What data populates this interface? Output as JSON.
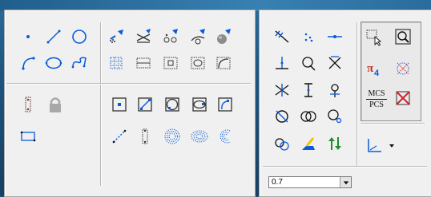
{
  "window": {
    "title": ""
  },
  "left_toolbar": {
    "row1": [
      "point-tool",
      "line-tool",
      "circle-tool",
      "arrow-plane-tool",
      "cross-lines-tool",
      "small-circles-tool",
      "angle-plane-tool",
      "grey-blob-tool"
    ],
    "row2": [
      "arc-tool",
      "ellipse-tool",
      "spline-tool",
      "dotted-grid-tool",
      "rect-lines-tool",
      "dotted-square-tool",
      "dotted-ellipse-tool",
      "dotted-corner-tool"
    ],
    "row3": [
      "dotted-vertical-rect-tool",
      "lock-tool",
      "bounded-square-tool",
      "bounded-diagonal-tool",
      "bounded-circle-tool",
      "bounded-oval-tool",
      "bounded-curve-tool"
    ],
    "row4": [
      "dotted-rect-tool",
      "dashed-diagonal-tool",
      "dotted-capsule-tool",
      "concentric-circles-tool",
      "concentric-ovals-tool",
      "c-shape-tool"
    ]
  },
  "right_toolbar": {
    "grid": [
      "arrow-x-tool",
      "dots-tool",
      "bar-tool",
      "perpendicular-tool",
      "triangle-a-tool",
      "x-cross-tool",
      "bowtie-tool",
      "i-beam-tool",
      "pin-tool",
      "circle-slash-tool",
      "double-circle-tool",
      "circle-dot-tool",
      "stacked-circles-tool",
      "brush-tool",
      "up-down-arrows-tool"
    ],
    "side": [
      "select-cursor-tool",
      "zoom-window-tool",
      "pi-star-tool",
      "dotted-star-tool",
      "mcs-pcs-tool",
      "red-x-tool"
    ],
    "mcs_label": "MCS",
    "pcs_label": "PCS",
    "pi_label": "π",
    "pi_number": "4"
  },
  "dropdown": {
    "value": "0.7"
  },
  "axis_menu": {
    "icon": "axis-icon"
  },
  "colors": {
    "accent": "#1a66d6",
    "blue": "#0b5bd8",
    "red": "#d11d2a",
    "green": "#1f8f2b",
    "yellow": "#f2c200",
    "bg": "#f0f0f0"
  }
}
